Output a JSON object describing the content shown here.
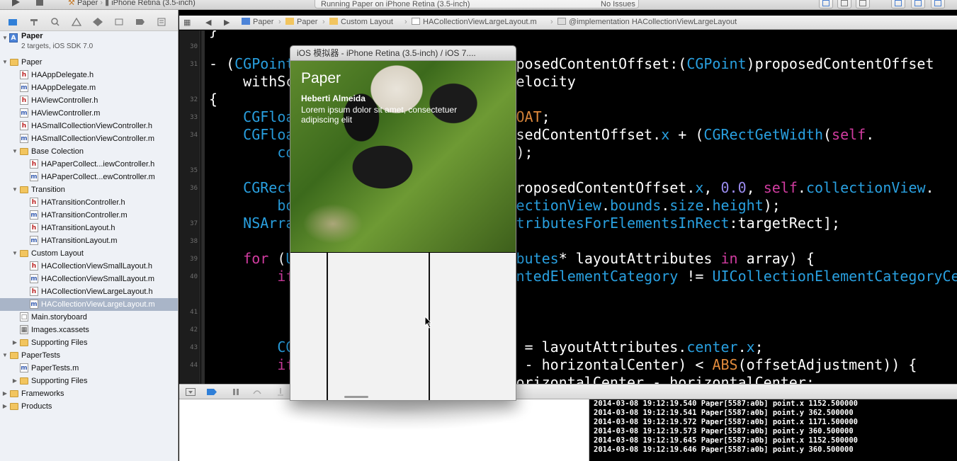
{
  "toolbar": {
    "scheme": "Paper",
    "destination": "iPhone Retina (3.5-inch)",
    "status": "Running Paper on iPhone Retina (3.5-inch)",
    "issues": "No Issues"
  },
  "navigator": {
    "project": {
      "name": "Paper",
      "subtitle": "2 targets, iOS SDK 7.0"
    },
    "items": [
      {
        "label": "Paper",
        "kind": "folder",
        "depth": 1,
        "open": true
      },
      {
        "label": "HAAppDelegate.h",
        "kind": "h",
        "depth": 2
      },
      {
        "label": "HAAppDelegate.m",
        "kind": "m",
        "depth": 2
      },
      {
        "label": "HAViewController.h",
        "kind": "h",
        "depth": 2
      },
      {
        "label": "HAViewController.m",
        "kind": "m",
        "depth": 2
      },
      {
        "label": "HASmallCollectionViewController.h",
        "kind": "h",
        "depth": 2
      },
      {
        "label": "HASmallCollectionViewController.m",
        "kind": "m",
        "depth": 2
      },
      {
        "label": "Base Colection",
        "kind": "folder",
        "depth": 2,
        "open": true
      },
      {
        "label": "HAPaperCollect...iewController.h",
        "kind": "h",
        "depth": 3
      },
      {
        "label": "HAPaperCollect...ewController.m",
        "kind": "m",
        "depth": 3
      },
      {
        "label": "Transition",
        "kind": "folder",
        "depth": 2,
        "open": true
      },
      {
        "label": "HATransitionController.h",
        "kind": "h",
        "depth": 3
      },
      {
        "label": "HATransitionController.m",
        "kind": "m",
        "depth": 3
      },
      {
        "label": "HATransitionLayout.h",
        "kind": "h",
        "depth": 3
      },
      {
        "label": "HATransitionLayout.m",
        "kind": "m",
        "depth": 3
      },
      {
        "label": "Custom Layout",
        "kind": "folder",
        "depth": 2,
        "open": true
      },
      {
        "label": "HACollectionViewSmallLayout.h",
        "kind": "h",
        "depth": 3
      },
      {
        "label": "HACollectionViewSmallLayout.m",
        "kind": "m",
        "depth": 3
      },
      {
        "label": "HACollectionViewLargeLayout.h",
        "kind": "h",
        "depth": 3
      },
      {
        "label": "HACollectionViewLargeLayout.m",
        "kind": "m",
        "depth": 3,
        "selected": true
      },
      {
        "label": "Main.storyboard",
        "kind": "sb",
        "depth": 2
      },
      {
        "label": "Images.xcassets",
        "kind": "xca",
        "depth": 2
      },
      {
        "label": "Supporting Files",
        "kind": "folder",
        "depth": 2,
        "open": false
      },
      {
        "label": "PaperTests",
        "kind": "folder",
        "depth": 1,
        "open": true
      },
      {
        "label": "PaperTests.m",
        "kind": "m",
        "depth": 2
      },
      {
        "label": "Supporting Files",
        "kind": "folder",
        "depth": 2,
        "open": false
      },
      {
        "label": "Frameworks",
        "kind": "folder",
        "depth": 1,
        "open": false
      },
      {
        "label": "Products",
        "kind": "folder",
        "depth": 1,
        "open": false
      }
    ]
  },
  "jumpbar": {
    "crumbs": [
      "Paper",
      "Paper",
      "Custom Layout",
      "HACollectionViewLargeLayout.m",
      "@implementation HACollectionViewLargeLayout"
    ]
  },
  "editor": {
    "line_numbers": [
      "30",
      "31",
      "32",
      "33",
      "34",
      "35",
      "36",
      "37",
      "38",
      "39",
      "40",
      "41",
      "42",
      "43",
      "44"
    ]
  },
  "simulator": {
    "window_title": "iOS 模拟器 - iPhone Retina (3.5-inch) / iOS 7....",
    "app_title": "Paper",
    "author": "Heberti Almeida",
    "description": "Lorem ipsum dolor sit amet, consectetuer adipiscing elit"
  },
  "console": {
    "lines": [
      "2014-03-08 19:12:19.540 Paper[5587:a0b] point.x 1152.500000",
      "2014-03-08 19:12:19.541 Paper[5587:a0b] point.y 362.500000",
      "2014-03-08 19:12:19.572 Paper[5587:a0b] point.x 1171.500000",
      "2014-03-08 19:12:19.573 Paper[5587:a0b] point.y 360.500000",
      "2014-03-08 19:12:19.645 Paper[5587:a0b] point.x 1152.500000",
      "2014-03-08 19:12:19.646 Paper[5587:a0b] point.y 360.500000"
    ]
  }
}
